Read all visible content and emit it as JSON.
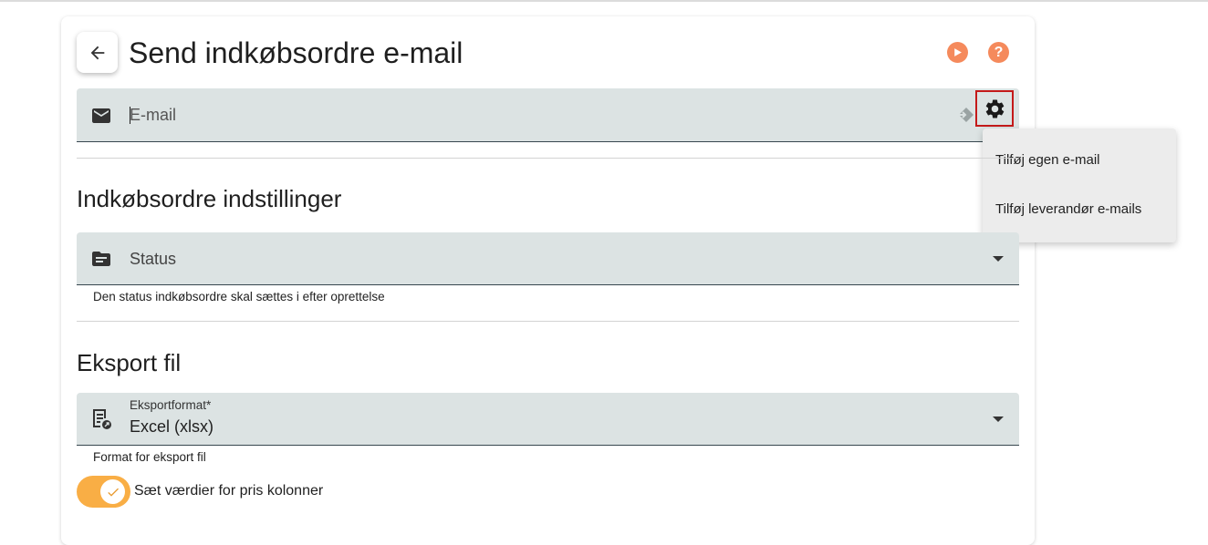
{
  "header": {
    "title": "Send indkøbsordre e-mail",
    "help_label": "?"
  },
  "email_field": {
    "placeholder": "E-mail"
  },
  "settings_menu": {
    "items": [
      {
        "label": "Tilføj egen e-mail"
      },
      {
        "label": "Tilføj leverandør e-mails"
      }
    ]
  },
  "order_settings": {
    "title": "Indkøbsordre indstillinger",
    "status_field": {
      "label": "Status",
      "hint": "Den status indkøbsordre skal sættes i efter oprettelse"
    }
  },
  "export": {
    "title": "Eksport fil",
    "format_field": {
      "label": "Eksportformat*",
      "value": "Excel (xlsx)",
      "hint": "Format for eksport fil"
    },
    "price_toggle": {
      "label": "Sæt værdier for pris kolonner",
      "checked": true
    }
  },
  "icons": [
    "back-arrow-icon",
    "play-icon",
    "help-icon",
    "mail-icon",
    "dynamic-value-icon",
    "gear-icon",
    "folder-icon",
    "export-file-icon",
    "check-icon",
    "chevron-down-icon"
  ],
  "colors": {
    "accent": "#f58a5c",
    "toggle": "#f9ae45",
    "field_background": "#dce3e3",
    "highlight_border": "#c41a1a"
  }
}
